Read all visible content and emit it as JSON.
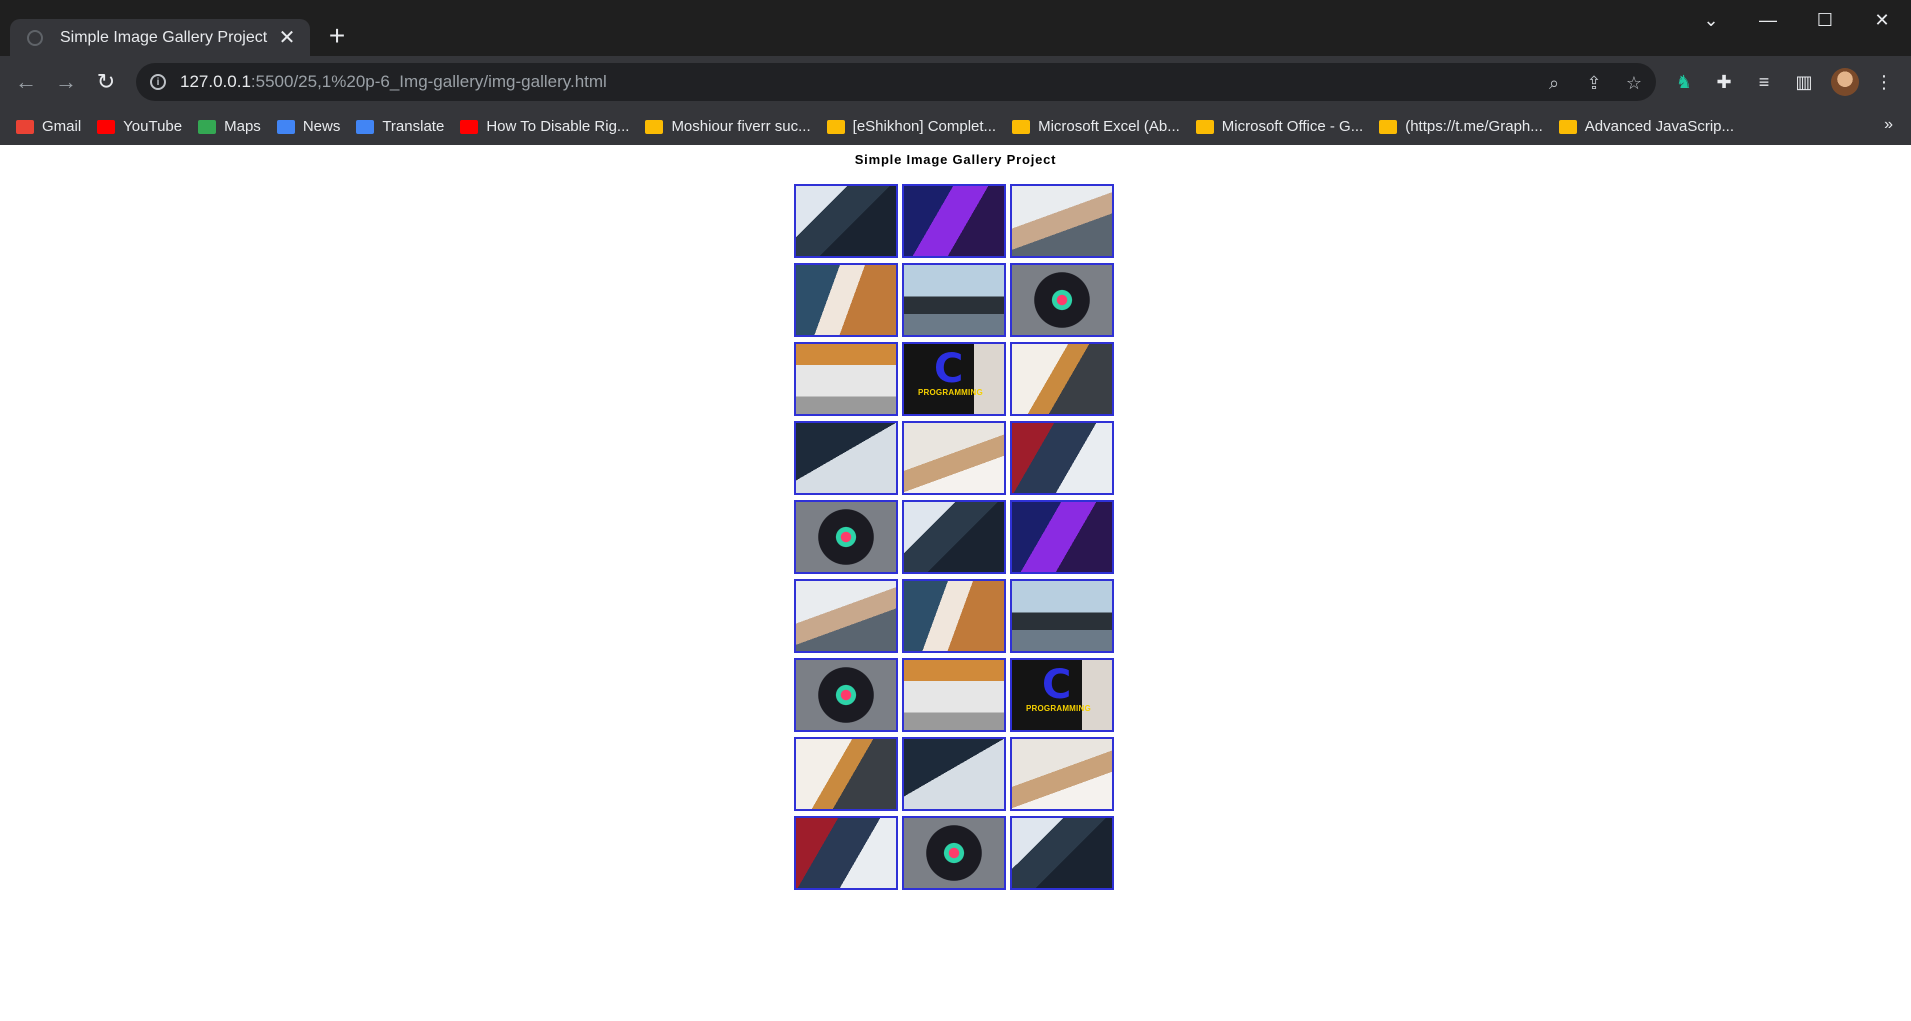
{
  "window": {
    "tab_title": "Simple Image Gallery Project",
    "new_tab_symbol": "+",
    "close_symbol": "✕"
  },
  "toolbar": {
    "url_host": "127.0.0.1",
    "url_path": ":5500/25,1%20p-6_Img-gallery/img-gallery.html"
  },
  "bookmarks": [
    {
      "label": "Gmail",
      "icon": "gmail-icon",
      "color": "#ea4335"
    },
    {
      "label": "YouTube",
      "icon": "youtube-icon",
      "color": "#ff0000"
    },
    {
      "label": "Maps",
      "icon": "maps-icon",
      "color": "#34a853"
    },
    {
      "label": "News",
      "icon": "news-icon",
      "color": "#4285f4"
    },
    {
      "label": "Translate",
      "icon": "translate-icon",
      "color": "#4285f4"
    },
    {
      "label": "How To Disable Rig...",
      "icon": "youtube-icon",
      "color": "#ff0000"
    },
    {
      "label": "Moshiour fiverr suc...",
      "icon": "drive-icon",
      "color": "#fbbc04"
    },
    {
      "label": "[eShikhon] Complet...",
      "icon": "drive-icon",
      "color": "#fbbc04"
    },
    {
      "label": "Microsoft Excel (Ab...",
      "icon": "drive-icon",
      "color": "#fbbc04"
    },
    {
      "label": "Microsoft Office - G...",
      "icon": "drive-icon",
      "color": "#fbbc04"
    },
    {
      "label": "(https://t.me/Graph...",
      "icon": "drive-icon",
      "color": "#fbbc04"
    },
    {
      "label": "Advanced JavaScrip...",
      "icon": "drive-icon",
      "color": "#fbbc04"
    }
  ],
  "bookmarks_more": "»",
  "page": {
    "title": "Simple Image Gallery Project"
  },
  "gallery": {
    "border_color": "#2f31d6",
    "c_letter": "C",
    "c_caption": "PROGRAMMING",
    "images": [
      "man-coding-monitor",
      "purple-keyboard-code",
      "hand-pointing-laptop",
      "two-people-coding",
      "woman-at-desk-monitor",
      "laptop-rgb-keyboard",
      "hands-typing-laptop",
      "c-programming-banner",
      "woman-coding-desk",
      "laptop-code-screen",
      "woman-headset-office",
      "man-laptop-office",
      "laptop-rgb-keyboard",
      "man-coding-monitor",
      "purple-keyboard-code",
      "hand-pointing-laptop",
      "two-people-coding",
      "woman-at-desk-monitor",
      "laptop-rgb-keyboard",
      "hands-typing-laptop",
      "c-programming-banner",
      "woman-coding-desk",
      "laptop-code-screen",
      "woman-headset-office",
      "man-laptop-office",
      "laptop-rgb-keyboard",
      "man-coding-monitor"
    ]
  }
}
